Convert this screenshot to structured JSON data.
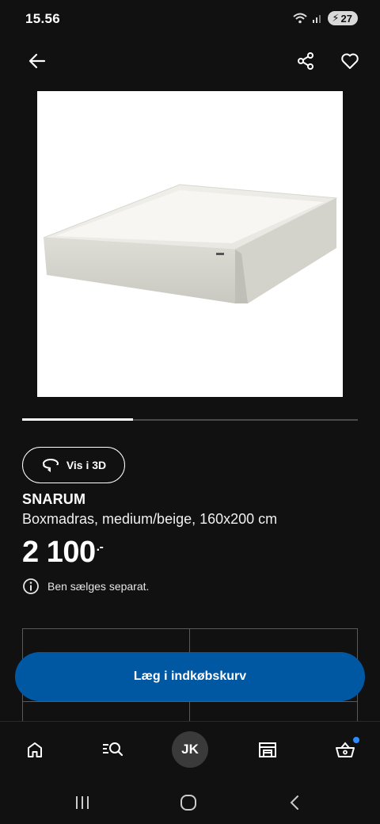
{
  "status_bar": {
    "time": "15.56",
    "battery": "27"
  },
  "top_bar": {
    "back_icon": "arrow-left-icon",
    "share_icon": "share-icon",
    "favourite_icon": "heart-icon"
  },
  "product": {
    "name": "SNARUM",
    "description": "Boxmadras, medium/beige, 160x200 cm",
    "price": "2 100",
    "price_suffix": ".-",
    "info_text": "Ben sælges separat.",
    "view_3d_label": "Vis i 3D",
    "carousel_progress": 0.33
  },
  "actions": {
    "add_to_cart_label": "Læg i indkøbskurv"
  },
  "bottom_nav": {
    "items": [
      {
        "icon": "home-icon"
      },
      {
        "icon": "search-icon"
      },
      {
        "label": "JK"
      },
      {
        "icon": "store-icon"
      },
      {
        "icon": "basket-icon",
        "has_notification": true
      }
    ]
  },
  "colors": {
    "background": "#111111",
    "accent": "#0058a3",
    "notification": "#2a8cff"
  }
}
